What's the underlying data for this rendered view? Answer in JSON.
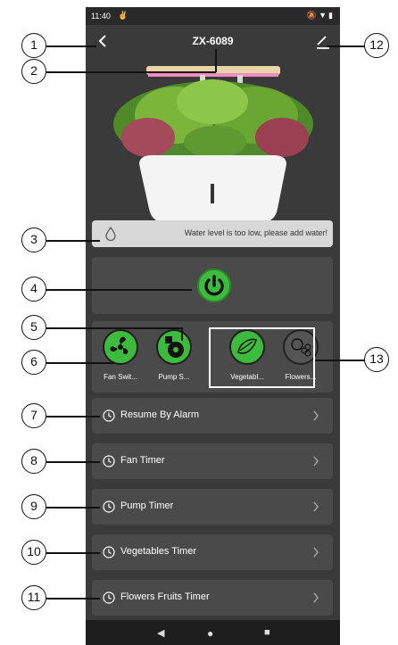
{
  "status_bar": {
    "time": "11:40"
  },
  "header": {
    "title": "ZX-6089"
  },
  "water_warning": {
    "message": "Water level is too low, please add water!"
  },
  "controls": [
    {
      "label": "Fan Swit...",
      "icon": "fan-icon",
      "state": "on"
    },
    {
      "label": "Pump S...",
      "icon": "pump-icon",
      "state": "on"
    },
    {
      "label": "Vegetabl...",
      "icon": "vegetables-icon",
      "state": "on"
    },
    {
      "label": "Flowers...",
      "icon": "flowers-icon",
      "state": "off"
    }
  ],
  "menu": [
    {
      "label": "Resume By Alarm"
    },
    {
      "label": "Fan Timer"
    },
    {
      "label": "Pump Timer"
    },
    {
      "label": "Vegetables Timer"
    },
    {
      "label": "Flowers Fruits Timer"
    }
  ],
  "callouts": [
    "1",
    "2",
    "3",
    "4",
    "5",
    "6",
    "7",
    "8",
    "9",
    "10",
    "11",
    "12",
    "13"
  ],
  "colors": {
    "accent_green": "#3dbb3d",
    "background": "#3a3a3a",
    "card": "#4a4a4a"
  }
}
